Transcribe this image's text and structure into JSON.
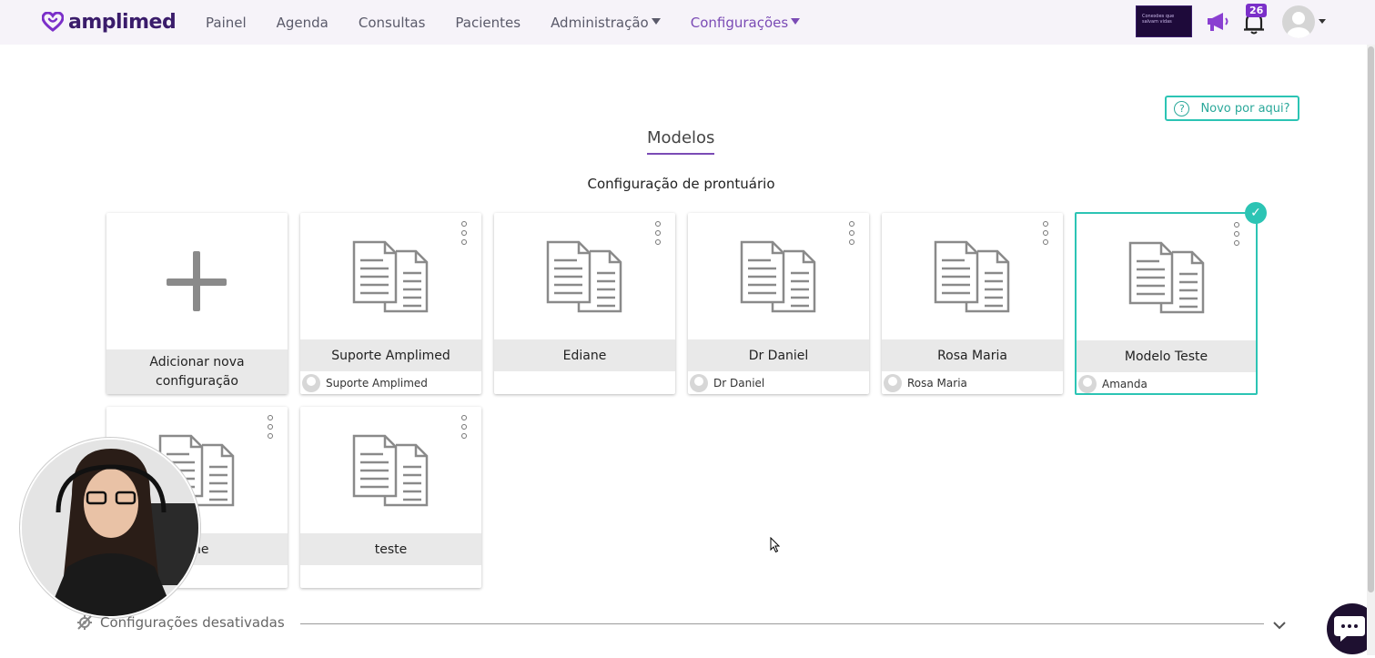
{
  "brand": {
    "name": "amplimed",
    "color": "#3a1c6b",
    "accent": "#7b4bb5",
    "teal": "#2cc4b4"
  },
  "nav": {
    "items": [
      {
        "label": "Painel",
        "dropdown": false,
        "active": false
      },
      {
        "label": "Agenda",
        "dropdown": false,
        "active": false
      },
      {
        "label": "Consultas",
        "dropdown": false,
        "active": false
      },
      {
        "label": "Pacientes",
        "dropdown": false,
        "active": false
      },
      {
        "label": "Administração",
        "dropdown": true,
        "active": false
      },
      {
        "label": "Configurações",
        "dropdown": true,
        "active": true
      }
    ]
  },
  "header": {
    "promo_text": "Conexões que salvam vidas",
    "notification_count": "26",
    "icons": {
      "announcements": "megaphone-icon",
      "notifications": "bell-icon",
      "user": "user-avatar"
    }
  },
  "help": {
    "label": "Novo por aqui?",
    "icon": "question-circle-icon"
  },
  "page": {
    "tab_title": "Modelos",
    "subtitle": "Configuração de prontuário"
  },
  "cards": {
    "add_label_line1": "Adicionar nova",
    "add_label_line2": "configuração",
    "items": [
      {
        "title": "Suporte Amplimed",
        "owner": "Suporte Amplimed",
        "selected": false
      },
      {
        "title": "Ediane",
        "owner": "",
        "selected": false
      },
      {
        "title": "Dr Daniel",
        "owner": "Dr Daniel",
        "selected": false
      },
      {
        "title": "Rosa Maria",
        "owner": "Rosa Maria",
        "selected": false
      },
      {
        "title": "Modelo Teste",
        "owner": "Amanda",
        "selected": true
      },
      {
        "title": "ane",
        "owner": "",
        "selected": false
      },
      {
        "title": "teste",
        "owner": "",
        "selected": false
      }
    ]
  },
  "footer": {
    "disabled_section_label": "Configurações desativadas",
    "disabled_icon": "gear-off-icon",
    "expand_icon": "chevron-down-icon",
    "chat_icon": "chat-icon"
  }
}
